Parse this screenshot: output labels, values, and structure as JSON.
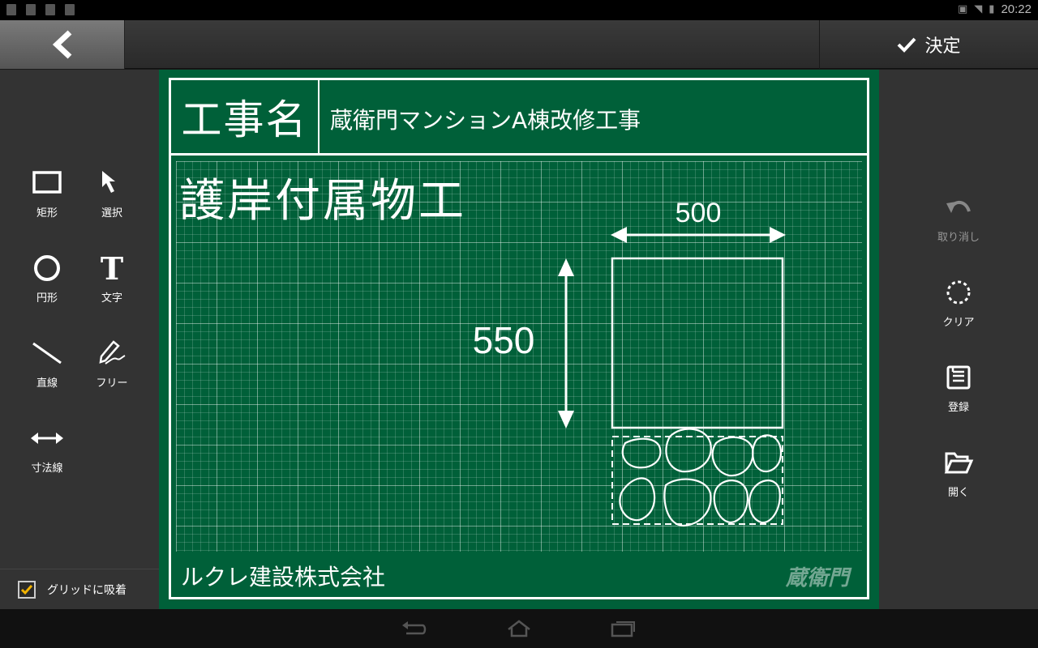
{
  "status_bar": {
    "time": "20:22"
  },
  "top_bar": {
    "decide_label": "決定"
  },
  "left_tools": [
    {
      "label": "矩形",
      "icon": "rectangle-icon"
    },
    {
      "label": "選択",
      "icon": "arrow-pointer-icon"
    },
    {
      "label": "円形",
      "icon": "circle-icon"
    },
    {
      "label": "文字",
      "icon": "text-icon"
    },
    {
      "label": "直線",
      "icon": "line-icon"
    },
    {
      "label": "フリー",
      "icon": "pen-icon"
    },
    {
      "label": "寸法線",
      "icon": "dimension-arrow-icon"
    }
  ],
  "grid_snap": {
    "label": "グリッドに吸着",
    "checked": true
  },
  "right_tools": [
    {
      "label": "取り消し",
      "icon": "undo-icon",
      "enabled": false
    },
    {
      "label": "クリア",
      "icon": "clear-icon",
      "enabled": true
    },
    {
      "label": "登録",
      "icon": "save-icon",
      "enabled": true
    },
    {
      "label": "開く",
      "icon": "open-folder-icon",
      "enabled": true
    }
  ],
  "board": {
    "title_label": "工事名",
    "project_name": "蔵衛門マンションA棟改修工事",
    "heading": "護岸付属物工",
    "dimension_width": "500",
    "dimension_height": "550",
    "company_name": "ルクレ建設株式会社",
    "brand": "蔵衛門"
  },
  "colors": {
    "board_green": "#006039",
    "panel": "#333333",
    "accent_check": "#f2b300"
  }
}
